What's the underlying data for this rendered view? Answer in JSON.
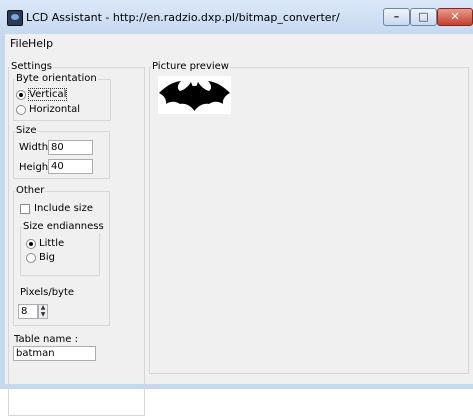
{
  "window": {
    "title": "LCD Assistant -  http://en.radzio.dxp.pl/bitmap_converter/",
    "controls": {
      "minimize": "–",
      "maximize": "□",
      "close": "✕"
    }
  },
  "menu": {
    "file": "File",
    "help": "Help"
  },
  "settings": {
    "legend": "Settings",
    "byte_orientation": {
      "legend": "Byte orientation",
      "options": [
        "Vertical",
        "Horizontal"
      ],
      "selected": "Vertical"
    },
    "size": {
      "legend": "Size",
      "width_label": "Width",
      "width_value": "80",
      "height_label": "Height",
      "height_value": "40"
    },
    "other": {
      "legend": "Other",
      "include_size_label": "Include size",
      "include_size_checked": false,
      "size_endianness": {
        "legend": "Size endianness",
        "options": [
          "Little",
          "Big"
        ],
        "selected": "Little"
      },
      "pixels_per_byte_label": "Pixels/byte",
      "pixels_per_byte_value": "8"
    },
    "table_name_label": "Table name :",
    "table_name_value": "batman"
  },
  "preview": {
    "legend": "Picture preview",
    "image": "batman-logo"
  },
  "colors": {
    "frame": "#c5d8ef",
    "client": "#f0f0f0",
    "close_button": "#c6402c",
    "group_border": "#d6d6d6"
  }
}
